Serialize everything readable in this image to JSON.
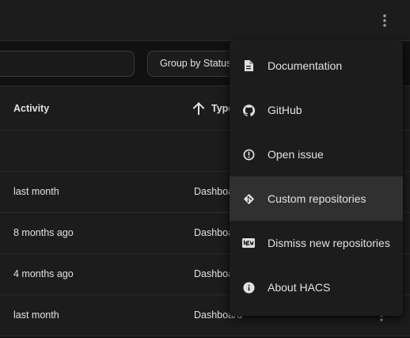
{
  "toolbar": {
    "group_by_label": "Group by Status"
  },
  "table": {
    "headers": {
      "activity": "Activity",
      "type": "Type"
    },
    "rows": [
      {
        "activity": "",
        "type": ""
      },
      {
        "activity": "last month",
        "type": "Dashboard"
      },
      {
        "activity": "8 months ago",
        "type": "Dashboard"
      },
      {
        "activity": "4 months ago",
        "type": "Dashboard"
      },
      {
        "activity": "last month",
        "type": "Dashboard"
      }
    ]
  },
  "menu": {
    "items": [
      {
        "label": "Documentation",
        "icon": "file-document-icon"
      },
      {
        "label": "GitHub",
        "icon": "github-icon"
      },
      {
        "label": "Open issue",
        "icon": "alert-circle-icon"
      },
      {
        "label": "Custom repositories",
        "icon": "git-icon",
        "highlighted": true
      },
      {
        "label": "Dismiss new repositories",
        "icon": "new-box-icon"
      },
      {
        "label": "About HACS",
        "icon": "information-icon"
      }
    ]
  },
  "colors": {
    "background": "#111111",
    "surface": "#1c1c1c",
    "menu_highlight": "#303030",
    "text": "#e1e1e1",
    "divider": "#2c2c2c"
  }
}
